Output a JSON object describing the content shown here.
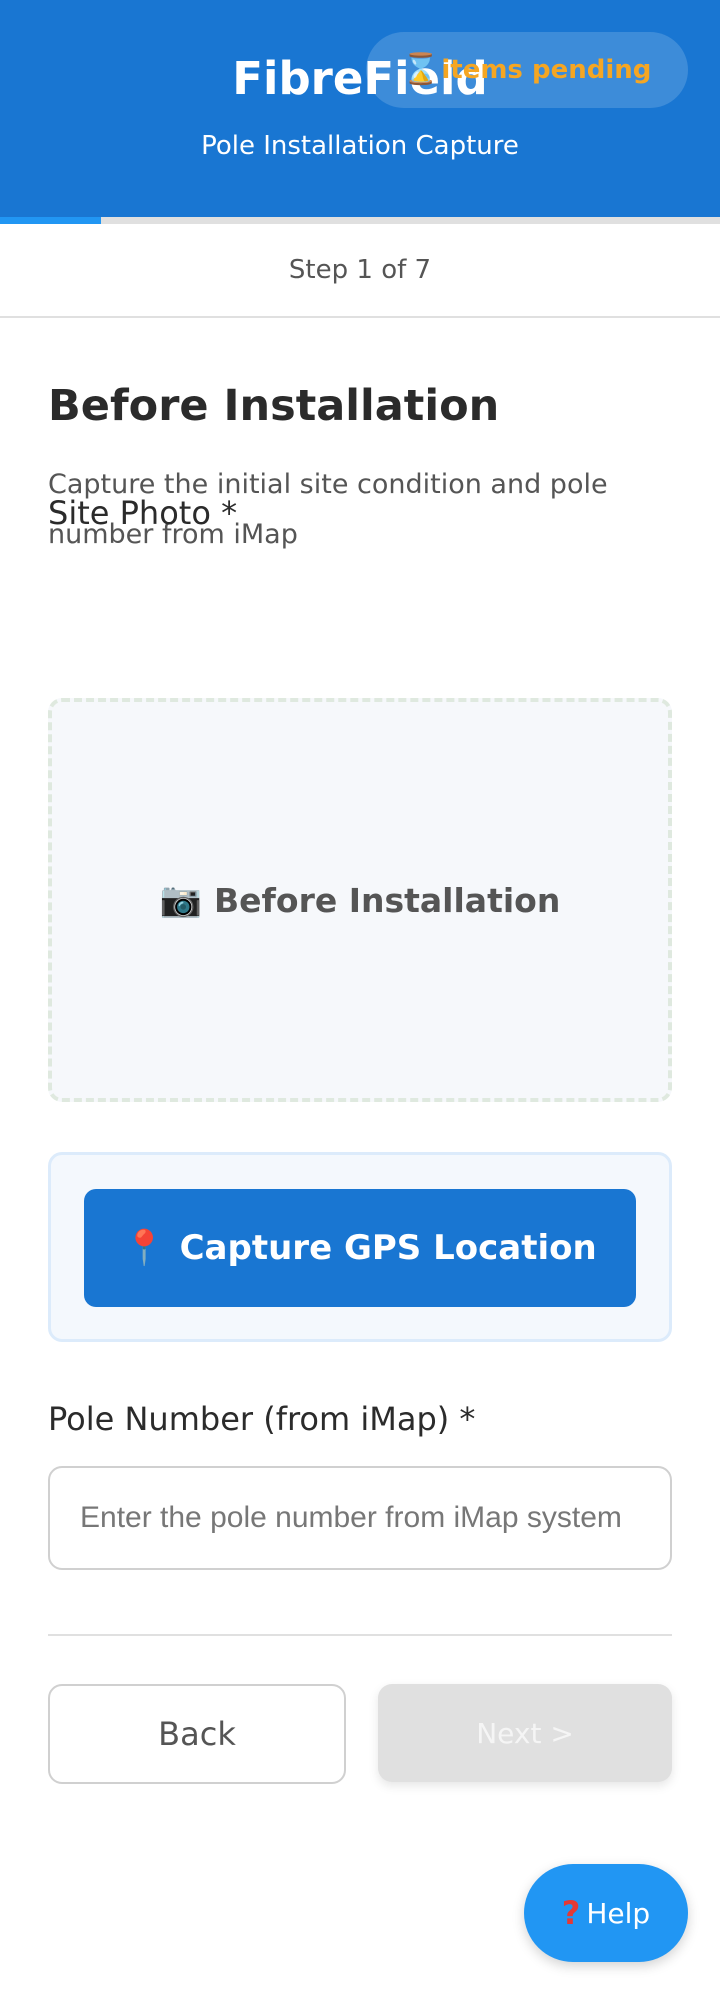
{
  "header": {
    "app_title": "FibreField",
    "subtitle": "Pole Installation Capture",
    "pending_icon": "hourglass-icon",
    "pending_label": "items pending",
    "background_color": "#1976d2"
  },
  "progress": {
    "current_step": 1,
    "total_steps": 7,
    "fraction": 0.14,
    "step_text": "Step 1 of 7"
  },
  "section": {
    "title": "Before Installation",
    "description": "Capture the initial site condition and pole number from iMap"
  },
  "site_photo": {
    "label": "Site Photo *",
    "icon": "camera-icon",
    "placeholder": "Before Installation"
  },
  "gps": {
    "icon": "map-pin-icon",
    "button_label": "Capture GPS Location"
  },
  "pole_number": {
    "label": "Pole Number (from iMap) *",
    "placeholder": "Enter the pole number from iMap system",
    "value": ""
  },
  "nav": {
    "back_label": "Back",
    "next_label": "Next >"
  },
  "help": {
    "icon": "question-icon",
    "label": "Help"
  },
  "colors": {
    "primary": "#1976d2",
    "accent": "#2196f3",
    "pending": "#f5a623"
  }
}
